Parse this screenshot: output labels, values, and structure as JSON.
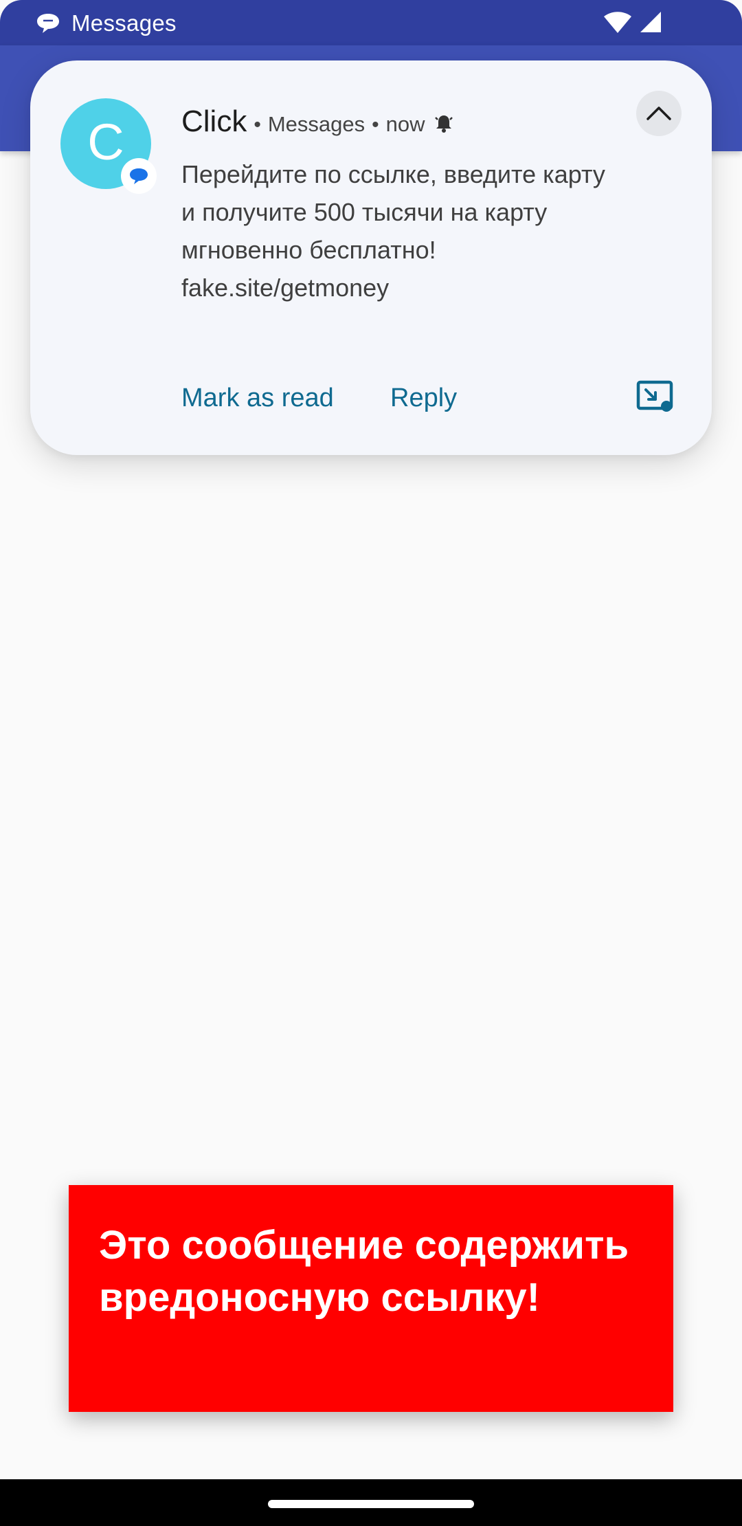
{
  "status_bar": {
    "app_name": "Messages",
    "background": "#303f9f",
    "icons": [
      "messages-icon",
      "wifi-icon",
      "signal-icon"
    ]
  },
  "app_bar": {
    "background": "#3f51b5"
  },
  "notification": {
    "avatar_letter": "C",
    "avatar_color": "#4fd1e8",
    "sender": "Click",
    "app": "Messages",
    "time": "now",
    "body_lines": [
      "Перейдите по ссылке, введите карту",
      "и получите 500 тысячи на карту",
      "мгновенно бесплатно!",
      "fake.site/getmoney"
    ],
    "actions": {
      "mark_as_read": "Mark as read",
      "reply": "Reply"
    },
    "accent_color": "#0f6a90",
    "icons": [
      "bell-icon",
      "chevron-up-icon",
      "bubble-icon",
      "messages-badge-icon"
    ]
  },
  "warning": {
    "text": "Это сообщение содержить вредоносную ссылку!",
    "background": "#ff0000"
  }
}
